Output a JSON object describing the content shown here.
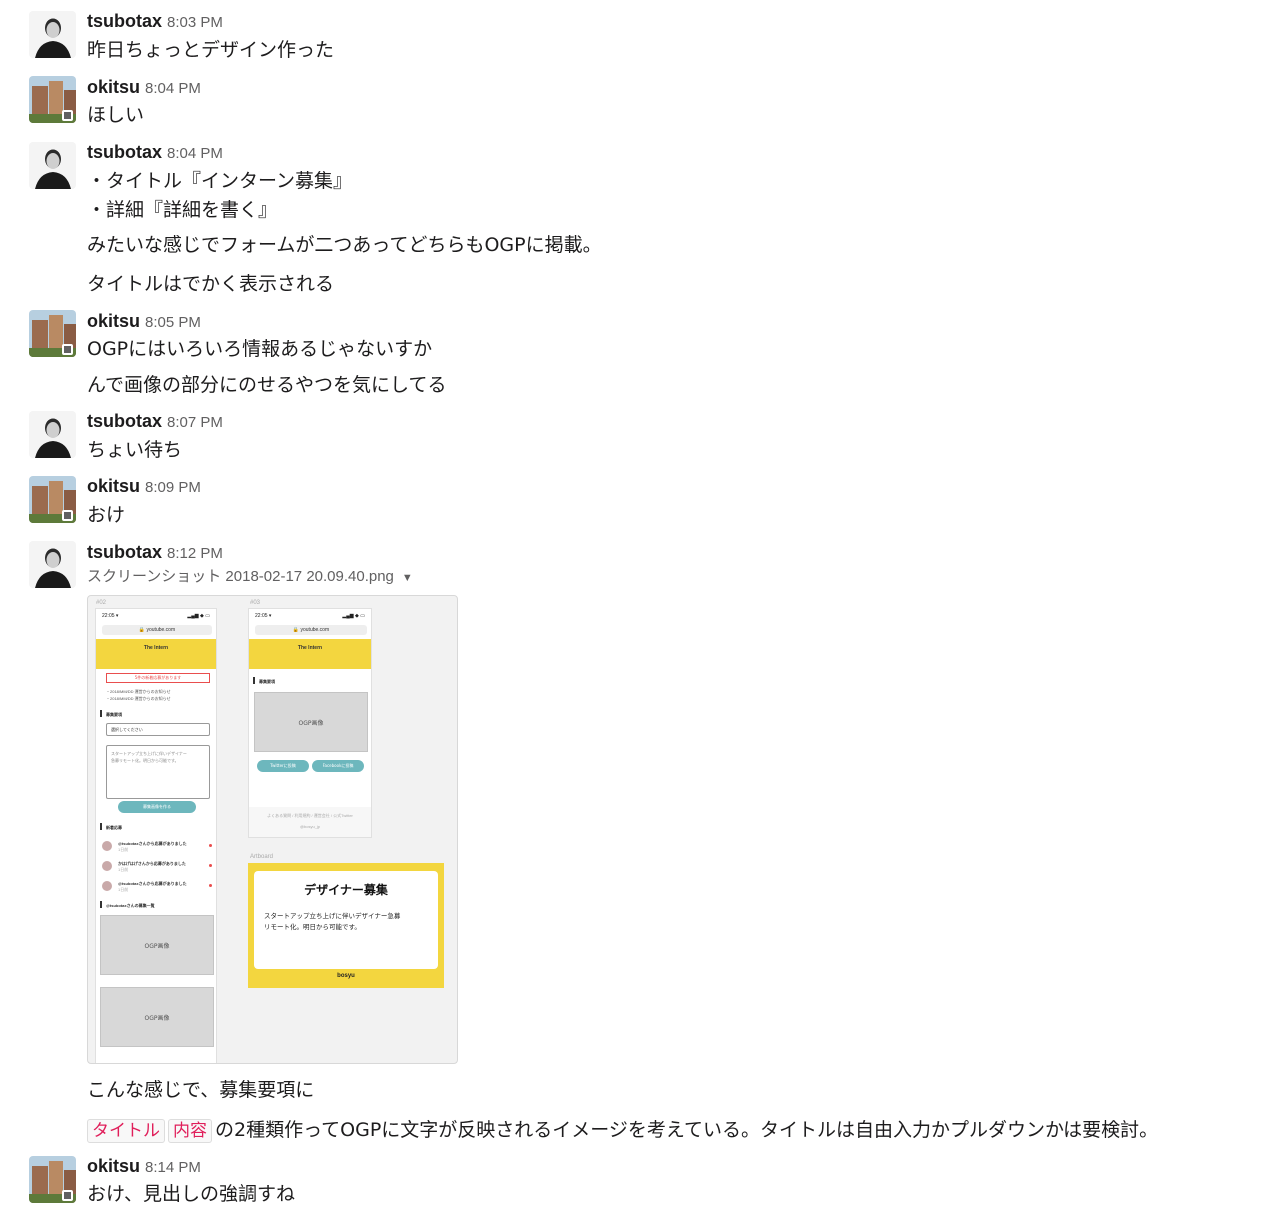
{
  "messages": [
    {
      "user": "tsubotax",
      "time": "8:03 PM",
      "lines": [
        "昨日ちょっとデザイン作った"
      ]
    },
    {
      "user": "okitsu",
      "time": "8:04 PM",
      "lines": [
        "ほしい"
      ]
    },
    {
      "user": "tsubotax",
      "time": "8:04 PM",
      "lines": [
        "・タイトル『インターン募集』",
        "・詳細『詳細を書く』",
        "みたいな感じでフォームが二つあってどちらもOGPに掲載。",
        "タイトルはでかく表示される"
      ]
    },
    {
      "user": "okitsu",
      "time": "8:05 PM",
      "lines": [
        "OGPにはいろいろ情報あるじゃないすか",
        "んで画像の部分にのせるやつを気にしてる"
      ]
    },
    {
      "user": "tsubotax",
      "time": "8:07 PM",
      "lines": [
        "ちょい待ち"
      ]
    },
    {
      "user": "okitsu",
      "time": "8:09 PM",
      "lines": [
        "おけ"
      ]
    },
    {
      "user": "tsubotax",
      "time": "8:12 PM",
      "file_name": "スクリーンショット 2018-02-17 20.09.40.png",
      "lines": [
        "こんな感じで、募集要項に"
      ],
      "code_tags": [
        "タイトル",
        "内容"
      ],
      "after_code": "の2種類作ってOGPに文字が反映されるイメージを考えている。タイトルは自由入力かプルダウンかは要検討。"
    },
    {
      "user": "okitsu",
      "time": "8:14 PM",
      "lines": [
        "おけ、見出しの強調すね"
      ]
    }
  ],
  "attachment": {
    "artboard_02": "#02",
    "artboard_03": "#03",
    "artboard_label": "Artboard",
    "phone_time": "22:05 ▾",
    "phone_signal": "▂▄▆ ◆ ▭",
    "url": "🔒 youtube.com",
    "app_title": "The Intern",
    "alert": "5件の新着応募があります",
    "news": [
      "・2018/MM/DD 運営からのお知らせ",
      "・2018/MM/DD 運営からのお知らせ"
    ],
    "section_recruit": "募集要項",
    "select_placeholder": "選択してください",
    "textarea_placeholder": [
      "スタートアップ立ち上げに伴いデザイナー",
      "急募リモート化。明日から可能です。"
    ],
    "create_button": "募集画像を作る",
    "section_new": "新着応募",
    "applicants": [
      "@tsubotaxさんから応募がありました",
      "かはげはげさんから応募がありました",
      "@tsubotaxさんから応募がありました"
    ],
    "applicant_time": "1日前",
    "section_list": "@tsubotaxさんの募集一覧",
    "ogp_label": "OGP画像",
    "twitter_button": "Twitterに投稿",
    "facebook_button": "Facebookに投稿",
    "footer_links": "よくある質問 / 利用規約 / 運営会社 / 公式Twitter",
    "footer_handle": "@bosyu_jp",
    "card_title": "デザイナー募集",
    "card_body": [
      "スタートアップ立ち上げに伴いデザイナー急募",
      "リモート化。明日から可能です。"
    ],
    "card_brand": "bosyu"
  },
  "colors": {
    "accent_yellow": "#f3d63f",
    "teal": "#6db7bd",
    "code_red": "#e01e5a",
    "presence": "#616061"
  }
}
